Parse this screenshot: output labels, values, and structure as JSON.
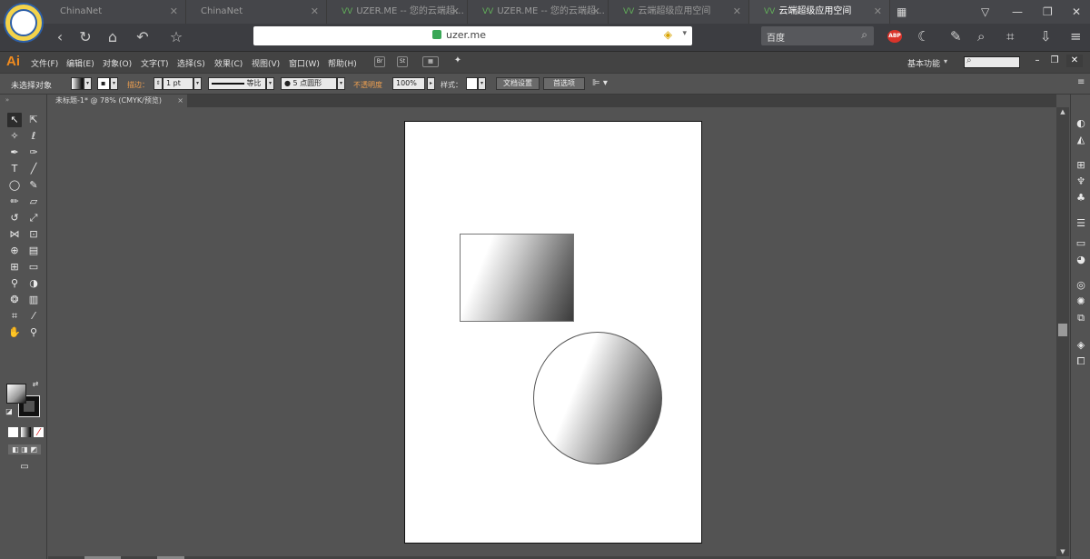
{
  "browser": {
    "tabs": [
      {
        "label": "ChinaNet",
        "active": false
      },
      {
        "label": "ChinaNet",
        "active": false
      },
      {
        "label": "UZER.ME -- 您的云端超…",
        "active": false
      },
      {
        "label": "UZER.ME -- 您的云端超…",
        "active": false
      },
      {
        "label": "云端超级应用空间",
        "active": false
      },
      {
        "label": "云端超级应用空间",
        "active": true
      }
    ],
    "address": "uzer.me",
    "search_placeholder": "百度",
    "abp_label": "ABP",
    "colors": {
      "tab_bar": "#45464a",
      "nav_bar": "#3c3d41",
      "secure_green": "#3aa757"
    }
  },
  "illustrator": {
    "logo": "Ai",
    "menus": [
      "文件(F)",
      "编辑(E)",
      "对象(O)",
      "文字(T)",
      "选择(S)",
      "效果(C)",
      "视图(V)",
      "窗口(W)",
      "帮助(H)"
    ],
    "menu_icons": [
      "Br",
      "St"
    ],
    "workspace": "基本功能",
    "control": {
      "selection_status": "未选择对象",
      "stroke_label": "描边：",
      "stroke_weight": "1 pt",
      "stroke_style": "等比",
      "brush": "5 点圆形",
      "opacity_label": "不透明度",
      "opacity_value": "100%",
      "style_label": "样式：",
      "doc_setup_button": "文档设置",
      "preferences_button": "首选项"
    },
    "document_tab": {
      "title": "未标题-1* @ 78% (CMYK/预览)",
      "close": "×"
    },
    "colors": {
      "accent_label": "#f0a050",
      "ui_bg": "#535353",
      "artboard": "#ffffff"
    }
  },
  "canvas": {
    "objects": [
      {
        "type": "rectangle",
        "fill": "linear gradient white→black"
      },
      {
        "type": "ellipse",
        "fill": "linear gradient white→black"
      }
    ]
  }
}
